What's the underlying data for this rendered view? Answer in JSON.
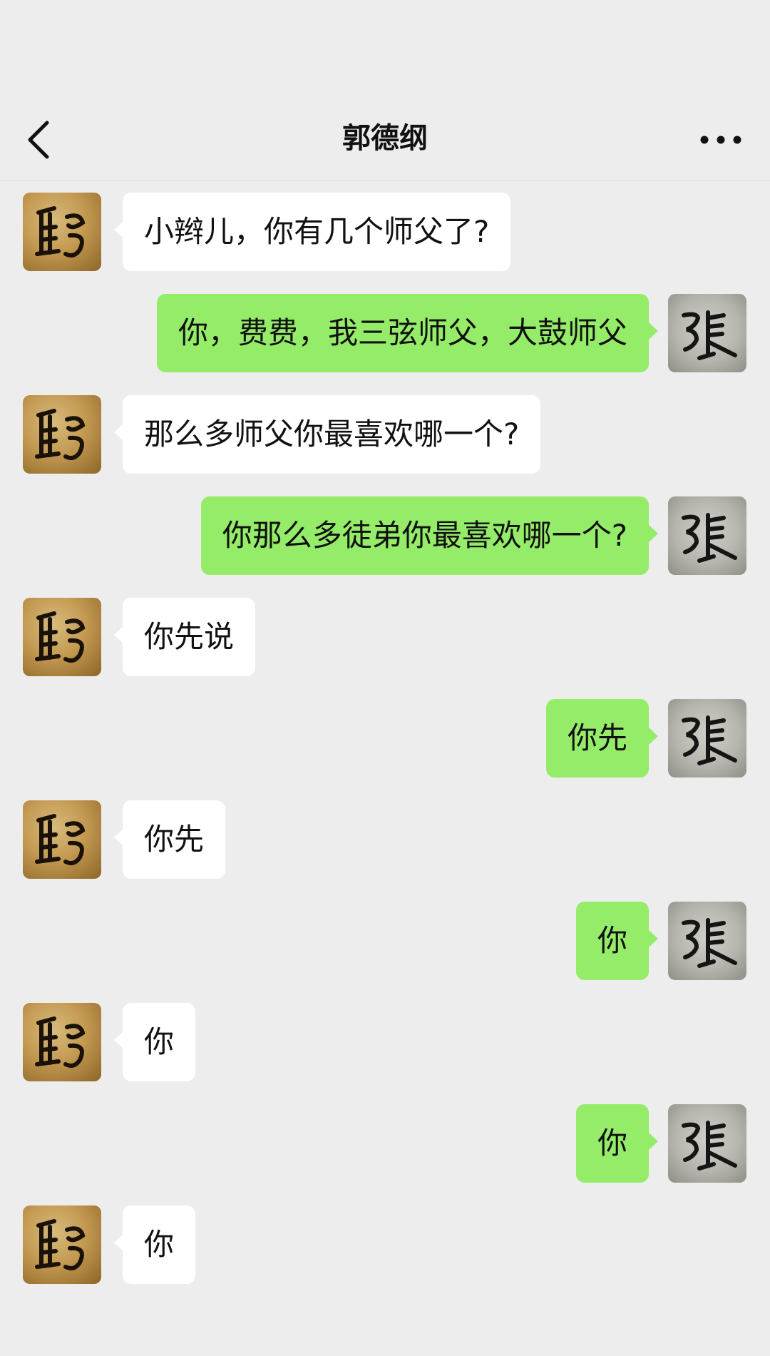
{
  "header": {
    "title": "郭德纲"
  },
  "contacts": {
    "left_avatar_icon": "calligraphy-guo-avatar-icon",
    "right_avatar_icon": "calligraphy-zhang-avatar-icon"
  },
  "messages": [
    {
      "side": "left",
      "text": "小辫儿，你有几个师父了?"
    },
    {
      "side": "right",
      "text": "你，费费，我三弦师父，大鼓师父"
    },
    {
      "side": "left",
      "text": "那么多师父你最喜欢哪一个?"
    },
    {
      "side": "right",
      "text": "你那么多徒弟你最喜欢哪一个?"
    },
    {
      "side": "left",
      "text": "你先说"
    },
    {
      "side": "right",
      "text": "你先"
    },
    {
      "side": "left",
      "text": "你先"
    },
    {
      "side": "right",
      "text": "你"
    },
    {
      "side": "left",
      "text": "你"
    },
    {
      "side": "right",
      "text": "你"
    },
    {
      "side": "left",
      "text": "你"
    }
  ],
  "colors": {
    "background": "#ededed",
    "incoming_bubble": "#ffffff",
    "outgoing_bubble": "#95ec69"
  }
}
